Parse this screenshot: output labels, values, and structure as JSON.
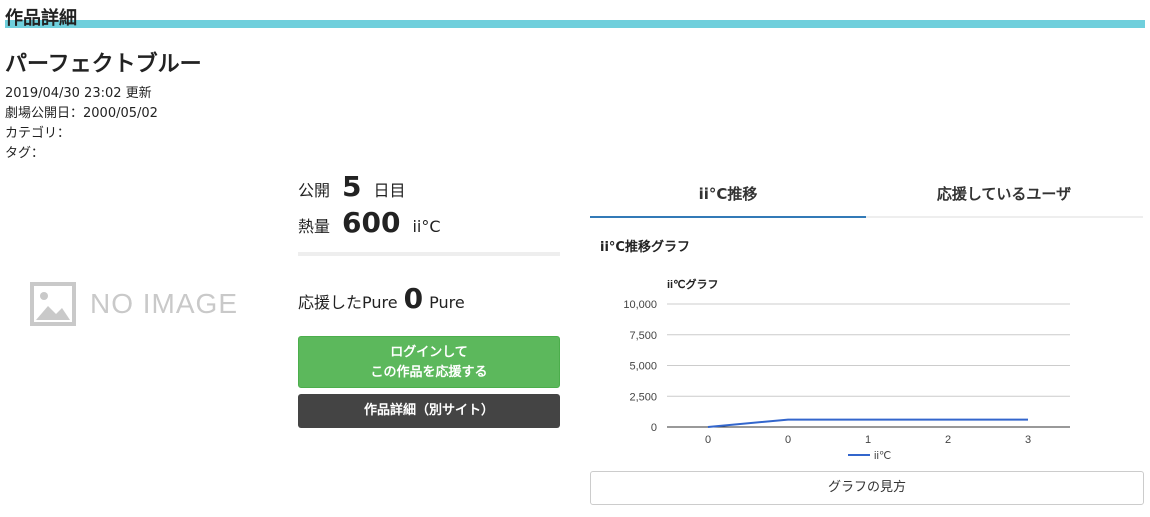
{
  "section": {
    "title": "作品詳細"
  },
  "work": {
    "title": "パーフェクトブルー",
    "updated": "2019/04/30 23:02 更新",
    "release": "劇場公開日：2000/05/02",
    "category": "カテゴリ：",
    "tags": "タグ："
  },
  "image": {
    "placeholder": "NO IMAGE"
  },
  "stats": {
    "public_label": "公開",
    "public_value": "5",
    "public_unit": "日目",
    "heat_label": "熱量",
    "heat_value": "600",
    "heat_unit": "ii°C",
    "support_label": "応援したPure",
    "support_value": "0",
    "support_unit": "Pure"
  },
  "buttons": {
    "support_line1": "ログインして",
    "support_line2": "この作品を応援する",
    "detail": "作品詳細（別サイト）",
    "howto": "グラフの見方"
  },
  "tabs": [
    {
      "label": "ii°C推移"
    },
    {
      "label": "応援しているユーザ"
    }
  ],
  "graph": {
    "section_title": "ii°C推移グラフ"
  },
  "colors": {
    "accent_bar": "#6fcfdc",
    "support_green": "#5cb85c",
    "detail_dark": "#444444",
    "tab_active": "#337ab7",
    "line": "#3366cc"
  },
  "chart_data": {
    "type": "line",
    "title": "ii℃グラフ",
    "categories": [
      "0",
      "0",
      "1",
      "2",
      "3"
    ],
    "series": [
      {
        "name": "ii℃",
        "values": [
          0,
          600,
          600,
          600,
          600
        ]
      }
    ],
    "ylim": [
      0,
      10000
    ],
    "yticks": [
      "0",
      "2,500",
      "5,000",
      "7,500",
      "10,000"
    ],
    "grid": true,
    "legend": "bottom"
  }
}
